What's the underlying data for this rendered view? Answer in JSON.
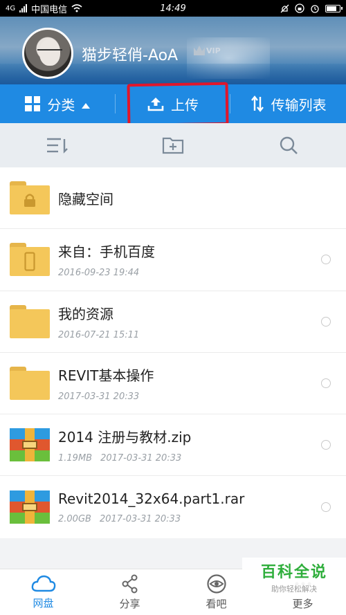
{
  "status_bar": {
    "network": "4G",
    "carrier": "中国电信",
    "time": "14:49"
  },
  "header": {
    "username": "猫步轻俏-AoA",
    "vip_badge": "VIP"
  },
  "actions": {
    "category": "分类",
    "upload": "上传",
    "transfer_list": "传输列表"
  },
  "toolbar": {
    "icons": [
      "sort-icon",
      "new-folder-icon",
      "search-icon"
    ]
  },
  "files": [
    {
      "name": "隐藏空间",
      "type": "locked-folder",
      "size": "",
      "date": ""
    },
    {
      "name": "来自：手机百度",
      "type": "phone-folder",
      "size": "",
      "date": "2016-09-23  19:44"
    },
    {
      "name": "我的资源",
      "type": "folder",
      "size": "",
      "date": "2016-07-21  15:11"
    },
    {
      "name": "REVIT基本操作",
      "type": "folder",
      "size": "",
      "date": "2017-03-31  20:33"
    },
    {
      "name": "2014 注册与教材.zip",
      "type": "archive",
      "size": "1.19MB",
      "date": "2017-03-31  20:33"
    },
    {
      "name": "Revit2014_32x64.part1.rar",
      "type": "archive",
      "size": "2.00GB",
      "date": "2017-03-31  20:33"
    }
  ],
  "bottom_nav": [
    {
      "label": "网盘",
      "icon": "cloud-icon",
      "active": true
    },
    {
      "label": "分享",
      "icon": "share-icon",
      "active": false
    },
    {
      "label": "看吧",
      "icon": "eye-icon",
      "active": false
    },
    {
      "label": "更多",
      "icon": "more-icon",
      "active": false
    }
  ],
  "watermark": {
    "title": "百科全说",
    "subtitle": "助你轻松解决"
  },
  "colors": {
    "accent": "#1f8ae3",
    "highlight": "#e0162b",
    "folder": "#f4c75a"
  }
}
